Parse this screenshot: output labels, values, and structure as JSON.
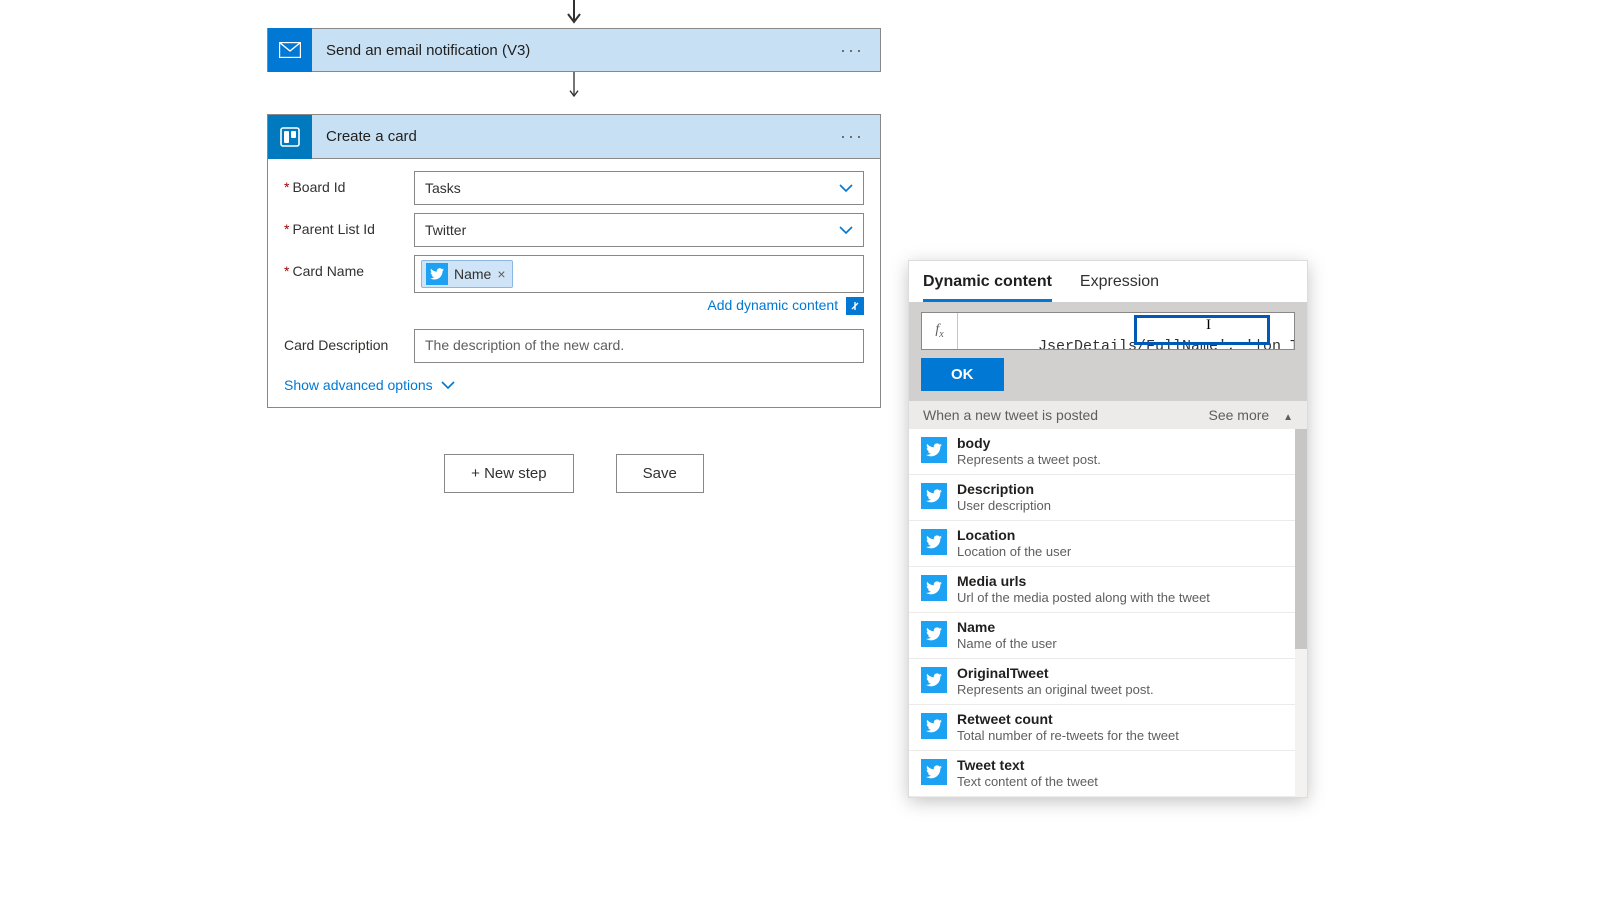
{
  "steps": {
    "email": {
      "title": "Send an email notification (V3)"
    },
    "trello": {
      "title": "Create a card",
      "fields": {
        "board_label": "Board Id",
        "board_value": "Tasks",
        "list_label": "Parent List Id",
        "list_value": "Twitter",
        "cardname_label": "Card Name",
        "cardname_token": "Name",
        "desc_label": "Card Description",
        "desc_placeholder": "The description of the new card."
      },
      "add_dynamic": "Add dynamic content",
      "advanced": "Show advanced options"
    }
  },
  "footer": {
    "new_step": "+ New step",
    "save": "Save"
  },
  "dc": {
    "tabs": {
      "dynamic": "Dynamic content",
      "expression": "Expression"
    },
    "fx": "fx",
    "expr": "JserDetails/FullName', '|on Twitter')",
    "ok": "OK",
    "group": "When a new tweet is posted",
    "seemore": "See more",
    "items": [
      {
        "title": "body",
        "desc": "Represents a tweet post."
      },
      {
        "title": "Description",
        "desc": "User description"
      },
      {
        "title": "Location",
        "desc": "Location of the user"
      },
      {
        "title": "Media urls",
        "desc": "Url of the media posted along with the tweet"
      },
      {
        "title": "Name",
        "desc": "Name of the user"
      },
      {
        "title": "OriginalTweet",
        "desc": "Represents an original tweet post."
      },
      {
        "title": "Retweet count",
        "desc": "Total number of re-tweets for the tweet"
      },
      {
        "title": "Tweet text",
        "desc": "Text content of the tweet"
      }
    ]
  }
}
